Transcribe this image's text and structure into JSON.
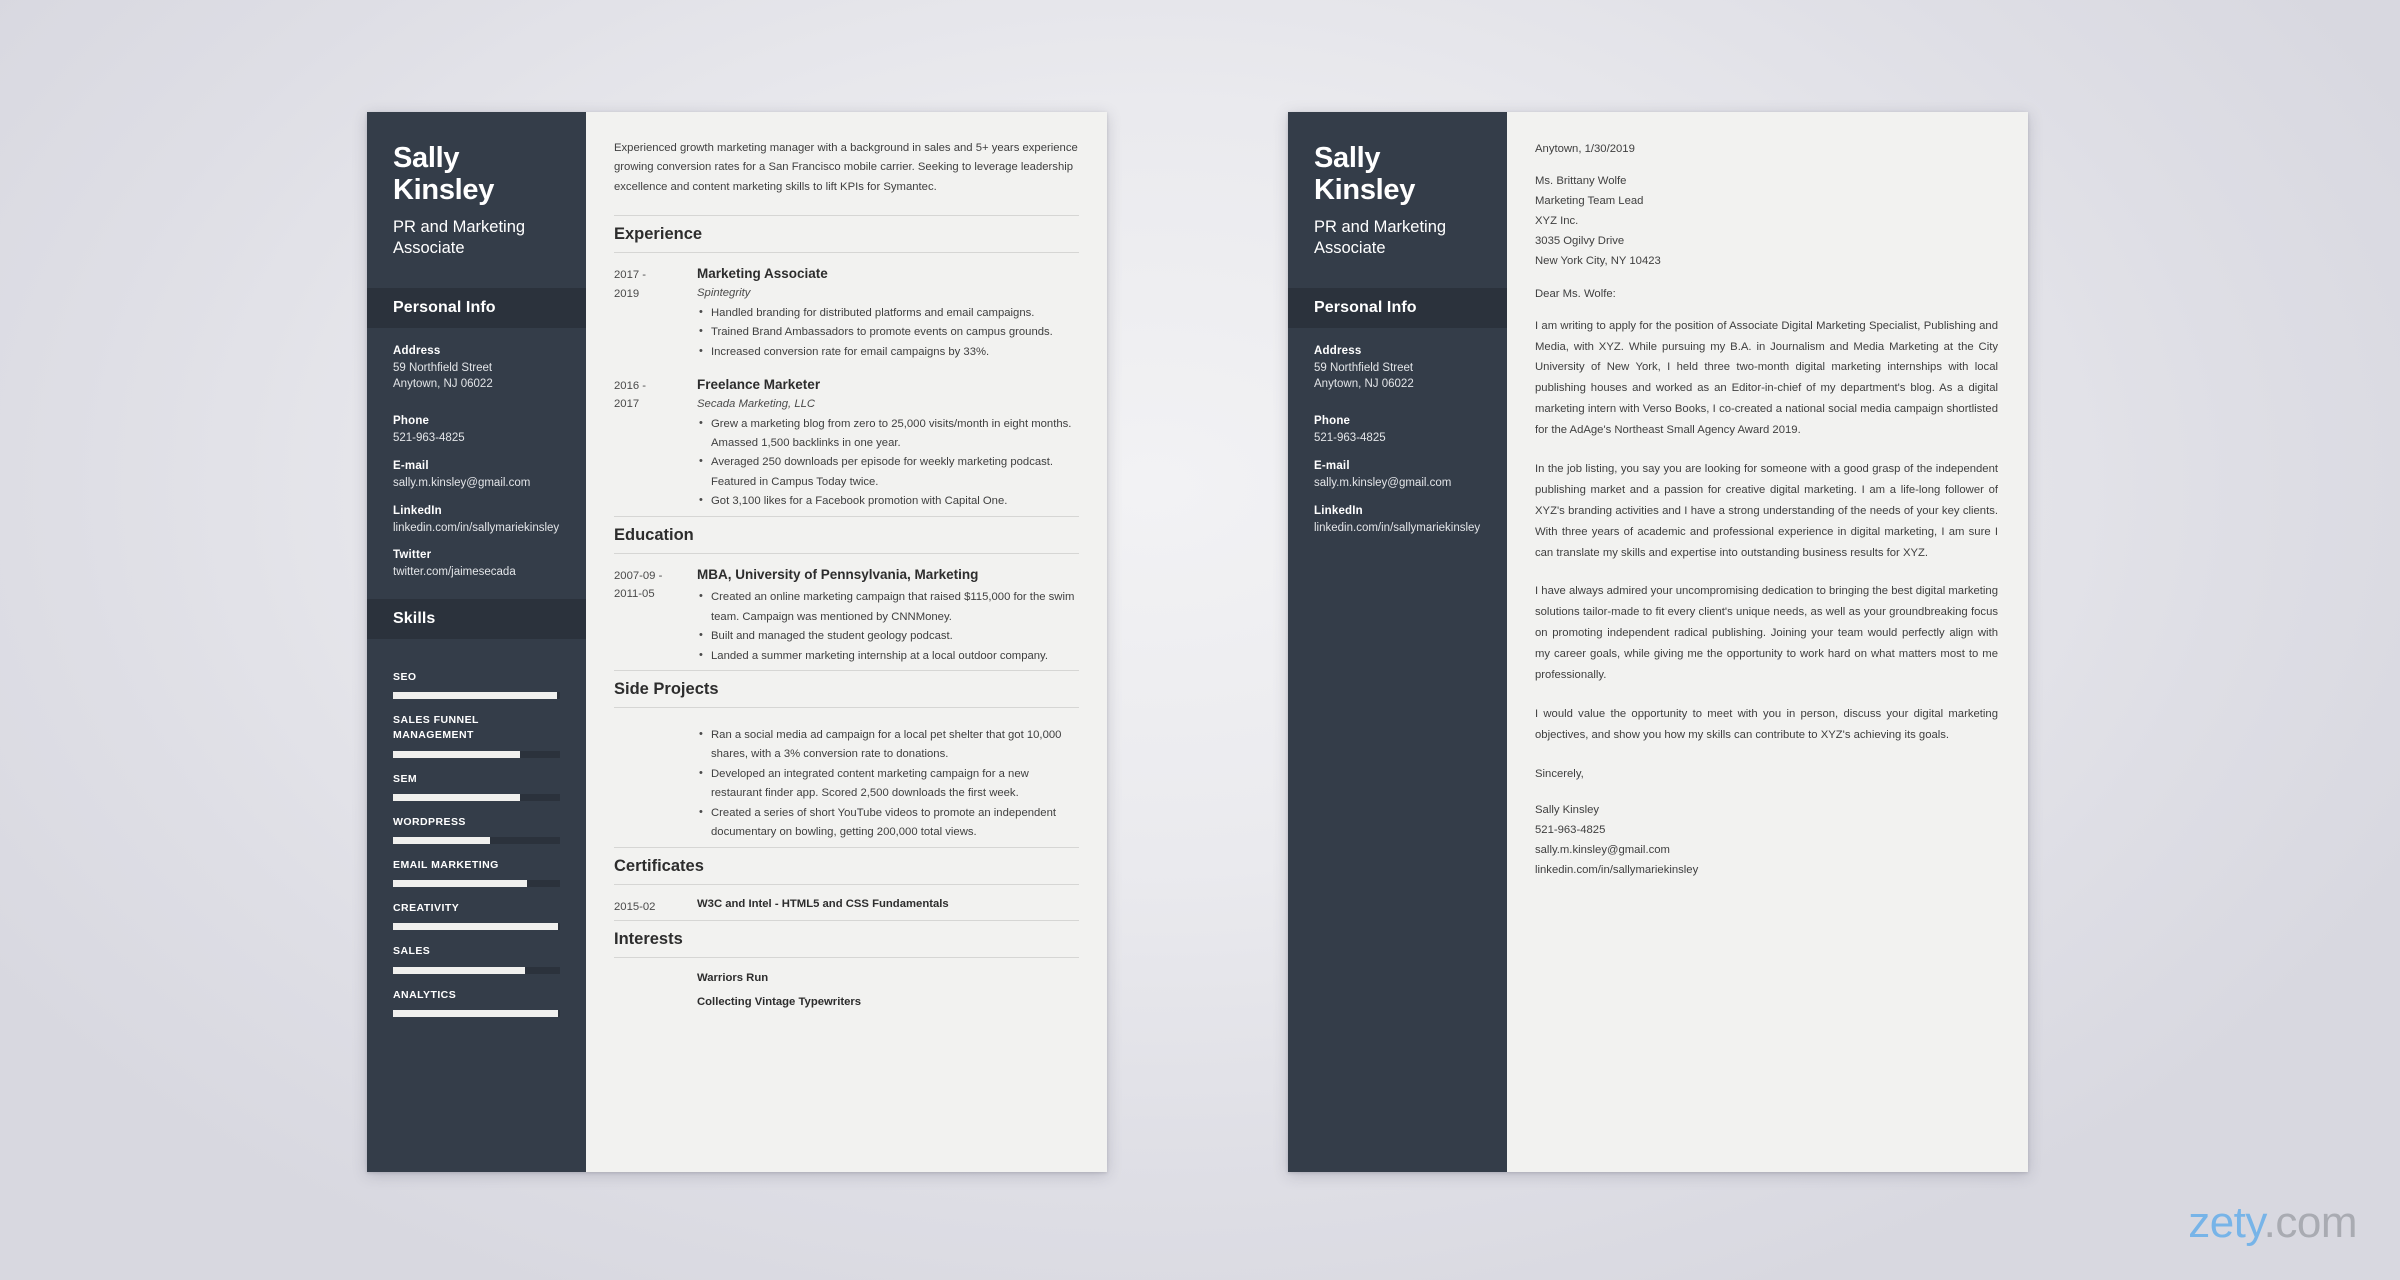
{
  "brand": {
    "name": "zety",
    "suffix": ".com",
    "accent": "#77b4e8",
    "suffix_color": "#a9abb2"
  },
  "theme": {
    "sidebar_bg": "#343d49",
    "sidebar_band": "#2b323c",
    "paper": "#f2f2f0",
    "text": "#3f3f3f"
  },
  "person": {
    "first_name": "Sally",
    "last_name": "Kinsley",
    "full_name": "Sally Kinsley",
    "job_title": "PR and Marketing Associate"
  },
  "resume": {
    "sidebar": {
      "personal_info_heading": "Personal Info",
      "skills_heading": "Skills",
      "contacts": [
        {
          "label": "Address",
          "value": "59 Northfield Street\nAnytown, NJ 06022"
        },
        {
          "label": "Phone",
          "value": "521-963-4825"
        },
        {
          "label": "E-mail",
          "value": "sally.m.kinsley@gmail.com"
        },
        {
          "label": "LinkedIn",
          "value": "linkedin.com/in/sallymariekinsley"
        },
        {
          "label": "Twitter",
          "value": "twitter.com/jaimesecada"
        }
      ],
      "skills": [
        {
          "name": "SEO",
          "level": 98
        },
        {
          "name": "SALES FUNNEL MANAGEMENT",
          "level": 76
        },
        {
          "name": "SEM",
          "level": 76
        },
        {
          "name": "WORDPRESS",
          "level": 58
        },
        {
          "name": "EMAIL MARKETING",
          "level": 80
        },
        {
          "name": "CREATIVITY",
          "level": 99
        },
        {
          "name": "SALES",
          "level": 79
        },
        {
          "name": "ANALYTICS",
          "level": 99
        }
      ]
    },
    "summary": "Experienced growth marketing manager with a background in sales and 5+ years experience growing conversion rates for a San Francisco mobile carrier. Seeking to leverage leadership excellence and content marketing skills to lift KPIs for Symantec.",
    "sections": {
      "experience_heading": "Experience",
      "education_heading": "Education",
      "side_projects_heading": "Side Projects",
      "certificates_heading": "Certificates",
      "interests_heading": "Interests"
    },
    "experience": [
      {
        "date": "2017 - 2019",
        "title": "Marketing Associate",
        "subtitle": "Spintegrity",
        "bullets": [
          "Handled branding for distributed platforms and email campaigns.",
          "Trained Brand Ambassadors to promote events on campus grounds.",
          "Increased conversion rate for email campaigns by 33%."
        ]
      },
      {
        "date": "2016 - 2017",
        "title": "Freelance Marketer",
        "subtitle": "Secada Marketing, LLC",
        "bullets": [
          "Grew a marketing blog from zero to 25,000 visits/month in eight months. Amassed 1,500 backlinks in one year.",
          "Averaged 250 downloads per episode for weekly marketing podcast. Featured in Campus Today twice.",
          "Got 3,100 likes for a Facebook promotion with Capital One."
        ]
      }
    ],
    "education": [
      {
        "date": "2007-09 - 2011-05",
        "title": "MBA, University of Pennsylvania, Marketing",
        "bullets": [
          "Created an online marketing campaign that raised $115,000 for the swim team. Campaign was mentioned by CNNMoney.",
          "Built and managed the student geology podcast.",
          "Landed a summer marketing internship at a local outdoor company."
        ]
      }
    ],
    "side_projects": [
      "Ran a social media ad campaign for a local pet shelter that got 10,000 shares, with a 3% conversion rate to donations.",
      "Developed an integrated content marketing campaign for a new restaurant finder app. Scored 2,500 downloads the first week.",
      "Created a series of short YouTube videos to promote an independent documentary on bowling, getting 200,000 total views."
    ],
    "certificates": [
      {
        "date": "2015-02",
        "title": "W3C and Intel - HTML5 and CSS Fundamentals"
      }
    ],
    "interests": [
      "Warriors Run",
      "Collecting Vintage Typewriters"
    ]
  },
  "cover_letter": {
    "sidebar": {
      "personal_info_heading": "Personal Info",
      "contacts": [
        {
          "label": "Address",
          "value": "59 Northfield Street\nAnytown, NJ 06022"
        },
        {
          "label": "Phone",
          "value": "521-963-4825"
        },
        {
          "label": "E-mail",
          "value": "sally.m.kinsley@gmail.com"
        },
        {
          "label": "LinkedIn",
          "value": "linkedin.com/in/sallymariekinsley"
        }
      ]
    },
    "dateline": "Anytown, 1/30/2019",
    "recipient": [
      "Ms. Brittany Wolfe",
      "Marketing Team Lead",
      "XYZ Inc.",
      "3035 Ogilvy Drive",
      "New York City, NY 10423"
    ],
    "salutation": "Dear Ms. Wolfe:",
    "paragraphs": [
      "I am writing to apply for the position of Associate Digital Marketing Specialist, Publishing and Media, with XYZ. While pursuing my B.A. in Journalism and Media Marketing at the City University of New York, I held three two-month digital marketing internships with local publishing houses and worked as an Editor-in-chief of my department's blog. As a digital marketing intern with Verso Books, I co-created a national social media campaign shortlisted for the AdAge's Northeast Small Agency Award 2019.",
      "In the job listing, you say you are looking for someone with a good grasp of the independent publishing market and a passion for creative digital marketing. I am a life-long follower of XYZ's branding activities and I have a strong understanding of the needs of your key clients. With three years of academic and professional experience in digital marketing, I am sure I can translate my skills and expertise into outstanding business results for XYZ.",
      "I have always admired your uncompromising dedication to bringing the best digital marketing solutions tailor-made to fit every client's unique needs, as well as your groundbreaking focus on promoting independent radical publishing. Joining your team would perfectly align with my career goals, while giving me the opportunity to work hard on what matters most to me professionally.",
      "I would value the opportunity to meet with you in person, discuss your digital marketing objectives, and show you how my skills can contribute to XYZ's achieving its goals."
    ],
    "closing": "Sincerely,",
    "signature": [
      "Sally Kinsley",
      "521-963-4825",
      "sally.m.kinsley@gmail.com",
      "linkedin.com/in/sallymariekinsley"
    ]
  }
}
